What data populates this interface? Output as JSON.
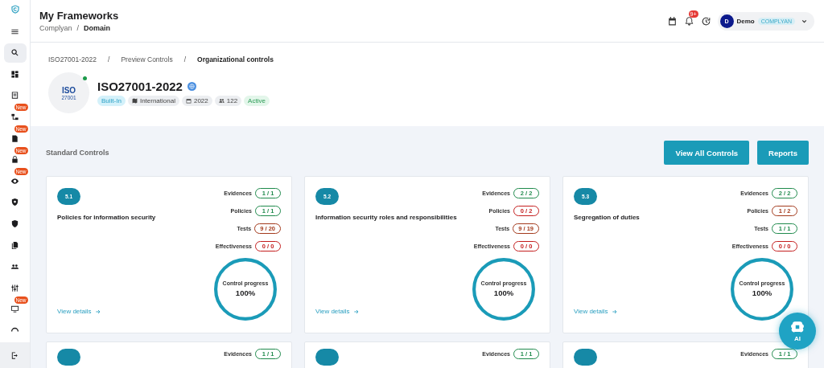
{
  "sidebar": {
    "items": [
      {
        "selected": false
      },
      {
        "selected": true
      },
      {
        "selected": false
      },
      {
        "selected": false
      },
      {
        "selected": false,
        "badge": "New"
      },
      {
        "selected": false,
        "badge": "New"
      },
      {
        "selected": false,
        "badge": "New"
      },
      {
        "selected": false,
        "badge": "New"
      },
      {
        "selected": false
      },
      {
        "selected": false
      },
      {
        "selected": false
      },
      {
        "selected": false
      },
      {
        "selected": false
      },
      {
        "selected": false,
        "badge": "New"
      },
      {
        "selected": false
      }
    ]
  },
  "header": {
    "title": "My Frameworks",
    "breadcrumb": {
      "items": [
        "Complyan",
        "Domain"
      ],
      "separator": "/"
    },
    "notifications": "9+",
    "user": {
      "initial": "D",
      "name": "Demo",
      "org": "COMPLYAN"
    }
  },
  "breadcrumb": {
    "items": [
      "ISO27001-2022",
      "Preview Controls",
      "Organizational controls"
    ],
    "separator": "/"
  },
  "framework": {
    "logo": "ISO",
    "logo_sub": "27001",
    "online": true,
    "name": "ISO27001-2022",
    "tags": [
      {
        "kind": "type",
        "label": "Built-In"
      },
      {
        "kind": "region",
        "label": "International"
      },
      {
        "kind": "year",
        "label": "2022"
      },
      {
        "kind": "users",
        "label": "122"
      },
      {
        "kind": "status",
        "label": "Active"
      }
    ]
  },
  "section": {
    "title": "Standard Controls",
    "buttons": [
      "View All Controls",
      "Reports"
    ]
  },
  "cards": [
    {
      "code": "5.1",
      "title": "Policies for information security",
      "metrics": [
        {
          "label": "Evidences",
          "value": "1 / 1",
          "color": "#1f8a4c"
        },
        {
          "label": "Policies",
          "value": "1 / 1",
          "color": "#1f8a4c"
        },
        {
          "label": "Tests",
          "value": "9 / 20",
          "color": "#a33a1c"
        },
        {
          "label": "Effectiveness",
          "value": "0 / 0",
          "color": "#c41e1e"
        }
      ],
      "progress_label": "Control progress",
      "progress_value": "100%",
      "level": 1,
      "link": "View details"
    },
    {
      "code": "5.2",
      "title": "Information security roles and responsibilities",
      "metrics": [
        {
          "label": "Evidences",
          "value": "2 / 2",
          "color": "#1f8a4c"
        },
        {
          "label": "Policies",
          "value": "0 / 2",
          "color": "#c41e1e"
        },
        {
          "label": "Tests",
          "value": "9 / 19",
          "color": "#a33a1c"
        },
        {
          "label": "Effectiveness",
          "value": "0 / 0",
          "color": "#c41e1e"
        }
      ],
      "progress_label": "Control progress",
      "progress_value": "100%",
      "level": 1,
      "link": "View details"
    },
    {
      "code": "5.3",
      "title": "Segregation of duties",
      "metrics": [
        {
          "label": "Evidences",
          "value": "2 / 2",
          "color": "#1f8a4c"
        },
        {
          "label": "Policies",
          "value": "1 / 2",
          "color": "#a33a1c"
        },
        {
          "label": "Tests",
          "value": "1 / 1",
          "color": "#1f8a4c"
        },
        {
          "label": "Effectiveness",
          "value": "0 / 0",
          "color": "#c41e1e"
        }
      ],
      "progress_label": "Control progress",
      "progress_value": "100%",
      "level": 1,
      "link": "View details"
    }
  ],
  "partial_cards": [
    {
      "label": "Evidences",
      "value": "1 / 1",
      "color": "#1f8a4c"
    },
    {
      "label": "Evidences",
      "value": "1 / 1",
      "color": "#1f8a4c"
    },
    {
      "label": "Evidences",
      "value": "1 / 1",
      "color": "#1f8a4c"
    }
  ],
  "ai_button": {
    "label": "AI"
  }
}
